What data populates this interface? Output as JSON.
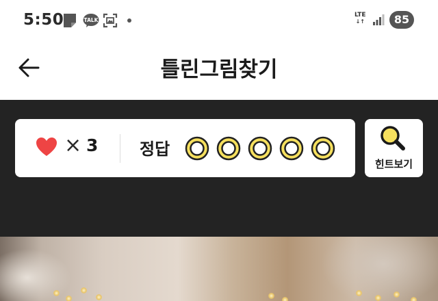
{
  "status_bar": {
    "time": "5:50",
    "notification_icons": [
      "document-icon",
      "kakaotalk-icon",
      "screenshot-icon",
      "dot-icon"
    ],
    "talk_icon_text": "TALK",
    "network": "LTE",
    "battery_level": "85"
  },
  "header": {
    "title": "틀린그림찾기",
    "back_icon": "arrow-left-icon"
  },
  "game_status": {
    "lives_icon": "heart-icon",
    "lives_multiplier": "×",
    "lives_count": "3",
    "answer_label": "정답",
    "answers_total": 5,
    "answers_found": 0,
    "slot_color": "#f6e05e"
  },
  "hint": {
    "label": "힌트보기",
    "icon": "search-icon"
  },
  "colors": {
    "panel_background": "#232323",
    "heart": "#ee4444",
    "slot_fill": "#f6e05e",
    "slot_stroke": "#222222"
  },
  "puzzle_image": {
    "description_icon": "photo-image"
  }
}
